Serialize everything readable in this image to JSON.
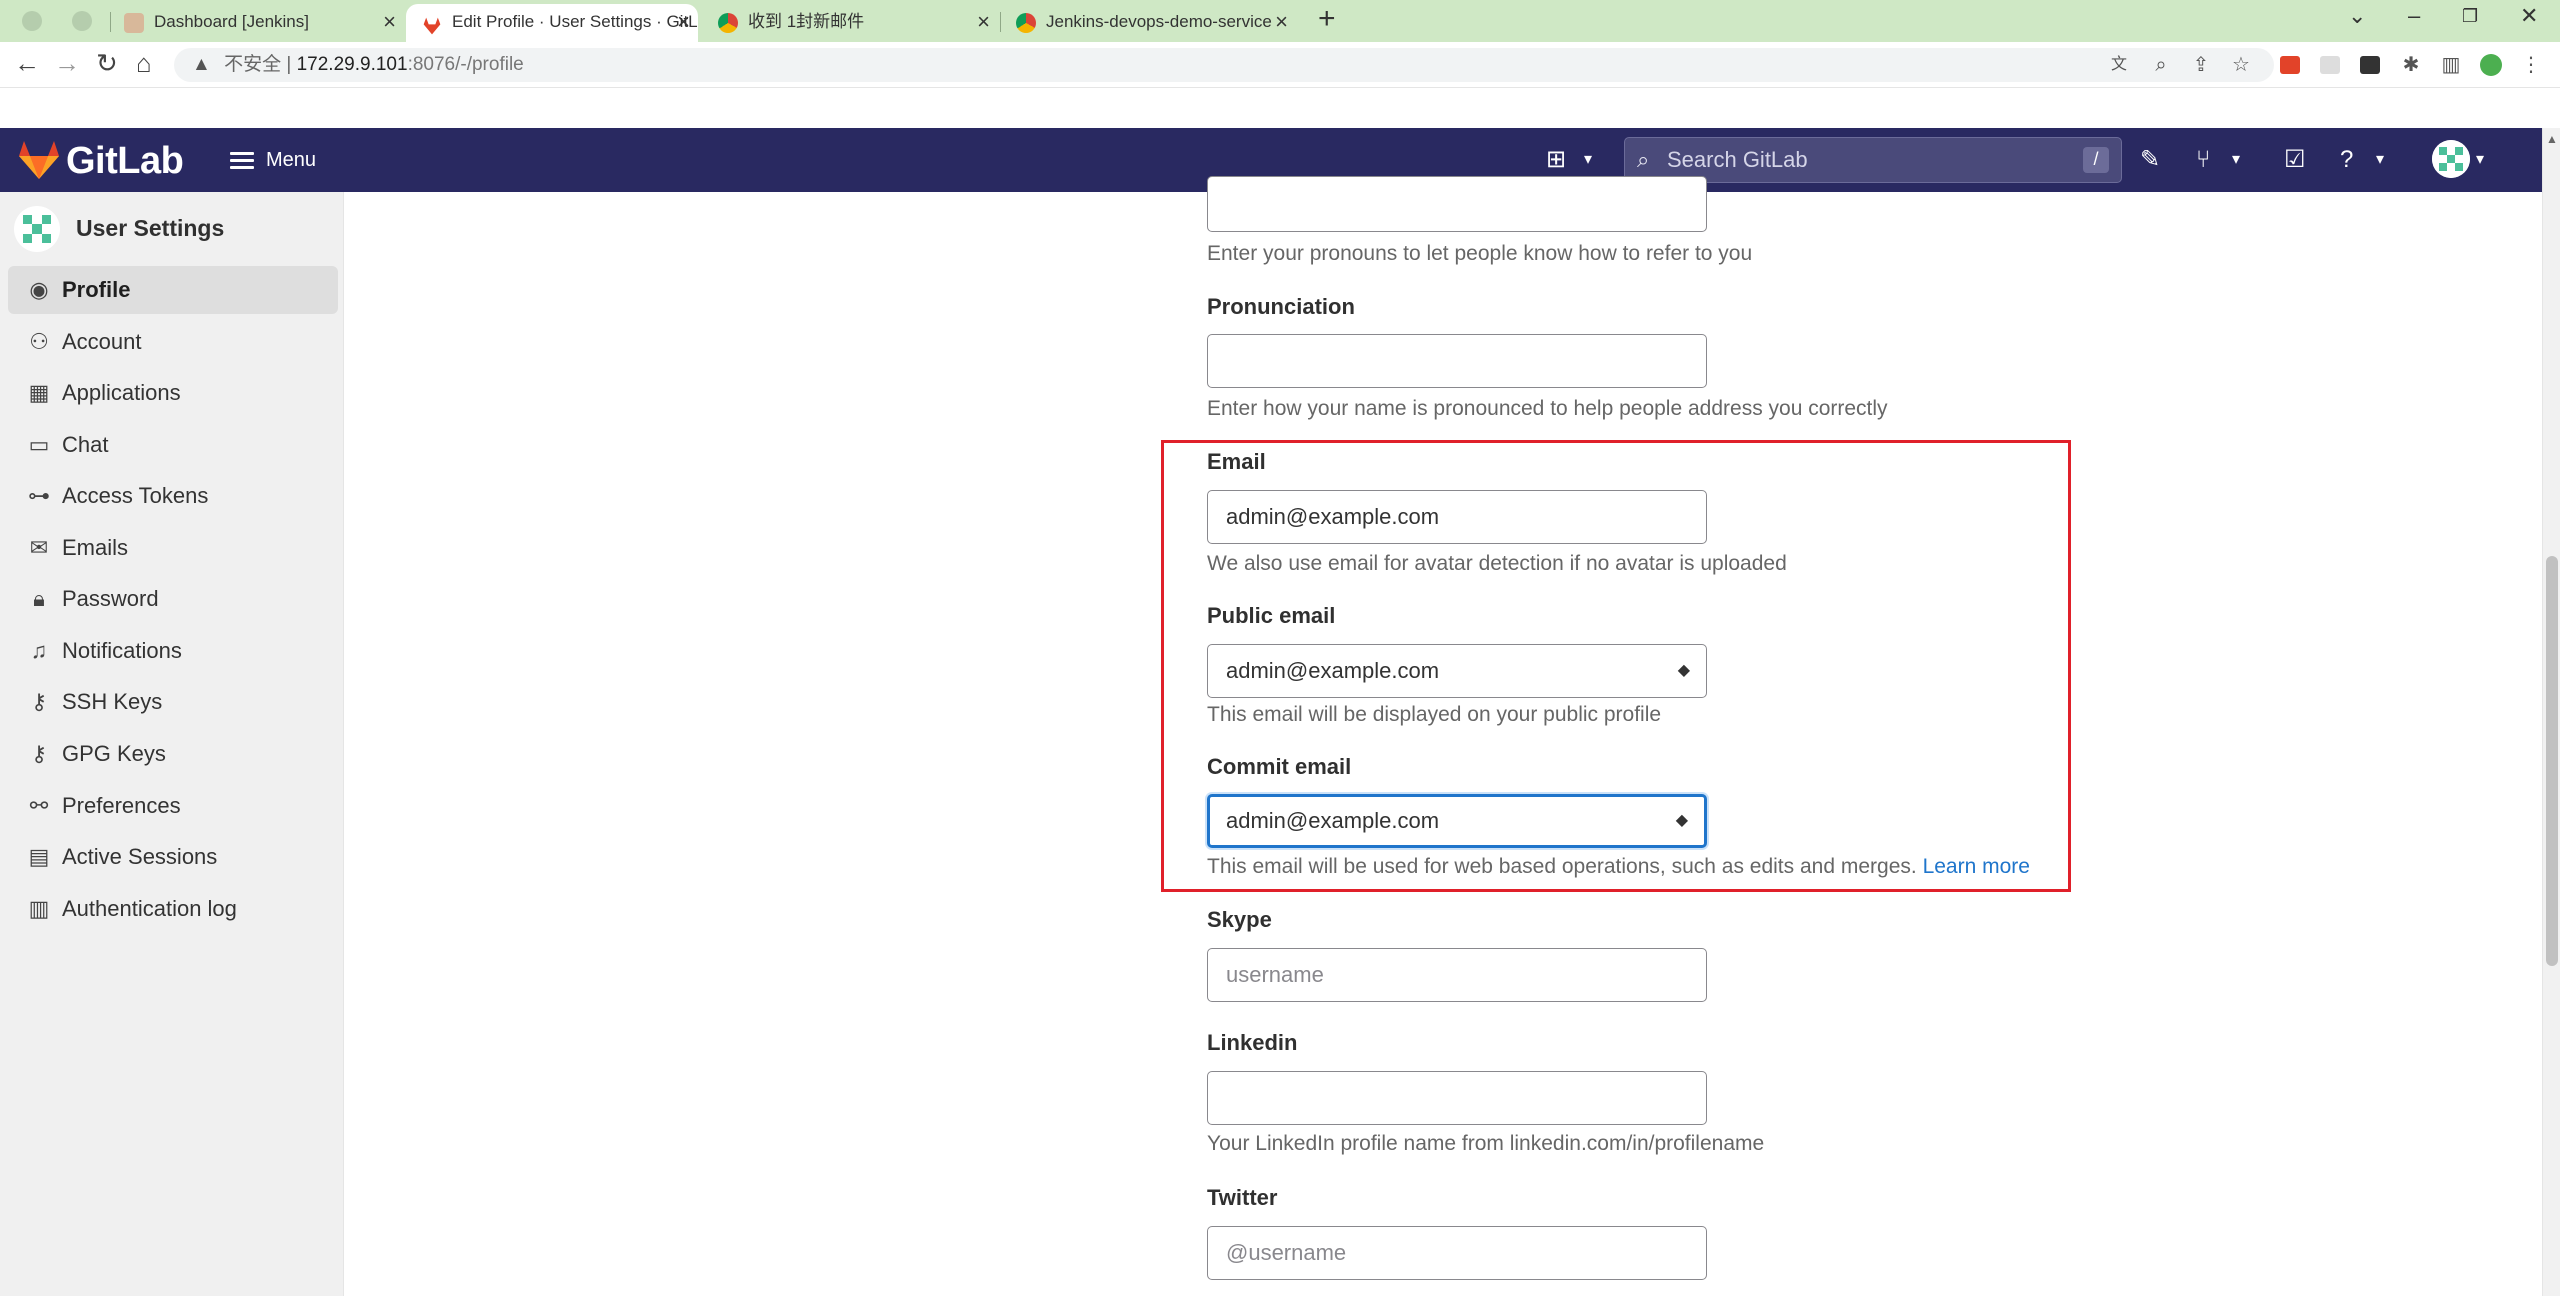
{
  "browser": {
    "tabs": [
      {
        "title": "Dashboard [Jenkins]",
        "favicon": "jenkins-icon"
      },
      {
        "title": "Edit Profile · User Settings · GitLab",
        "favicon": "gitlab-icon",
        "active": true
      },
      {
        "title": "收到 1封新邮件",
        "favicon": "chrome-icon"
      },
      {
        "title": "Jenkins-devops-demo-service",
        "favicon": "chrome-icon"
      }
    ],
    "address": {
      "warning": "▲",
      "insecure_label": "不安全",
      "separator": "|",
      "host": "172.29.9.101",
      "path": ":8076/-/profile"
    }
  },
  "gitlab_header": {
    "brand": "GitLab",
    "menu_label": "Menu",
    "search_placeholder": "Search GitLab",
    "search_shortcut": "/",
    "colors": {
      "header_bg": "#292961",
      "logo": "#e24329"
    }
  },
  "sidebar": {
    "title": "User Settings",
    "items": [
      {
        "label": "Profile",
        "icon": "profile-icon",
        "active": true
      },
      {
        "label": "Account",
        "icon": "account-icon"
      },
      {
        "label": "Applications",
        "icon": "applications-icon"
      },
      {
        "label": "Chat",
        "icon": "chat-icon"
      },
      {
        "label": "Access Tokens",
        "icon": "token-icon"
      },
      {
        "label": "Emails",
        "icon": "mail-icon"
      },
      {
        "label": "Password",
        "icon": "lock-icon"
      },
      {
        "label": "Notifications",
        "icon": "bell-icon"
      },
      {
        "label": "SSH Keys",
        "icon": "key-icon"
      },
      {
        "label": "GPG Keys",
        "icon": "key-icon"
      },
      {
        "label": "Preferences",
        "icon": "preferences-icon"
      },
      {
        "label": "Active Sessions",
        "icon": "monitor-icon"
      },
      {
        "label": "Authentication log",
        "icon": "log-icon"
      }
    ]
  },
  "form": {
    "pronouns": {
      "value": "",
      "hint": "Enter your pronouns to let people know how to refer to you"
    },
    "pronunciation": {
      "label": "Pronunciation",
      "value": "",
      "hint": "Enter how your name is pronounced to help people address you correctly"
    },
    "email": {
      "label": "Email",
      "value": "admin@example.com",
      "hint": "We also use email for avatar detection if no avatar is uploaded"
    },
    "public_email": {
      "label": "Public email",
      "value": "admin@example.com",
      "hint": "This email will be displayed on your public profile"
    },
    "commit_email": {
      "label": "Commit email",
      "value": "admin@example.com",
      "hint": "This email will be used for web based operations, such as edits and merges.",
      "link": "Learn more"
    },
    "skype": {
      "label": "Skype",
      "placeholder": "username"
    },
    "linkedin": {
      "label": "Linkedin",
      "value": "",
      "hint": "Your LinkedIn profile name from linkedin.com/in/profilename"
    },
    "twitter": {
      "label": "Twitter",
      "placeholder": "@username"
    },
    "highlight_color": "#e0202a",
    "focus_color": "#1f75cb"
  }
}
